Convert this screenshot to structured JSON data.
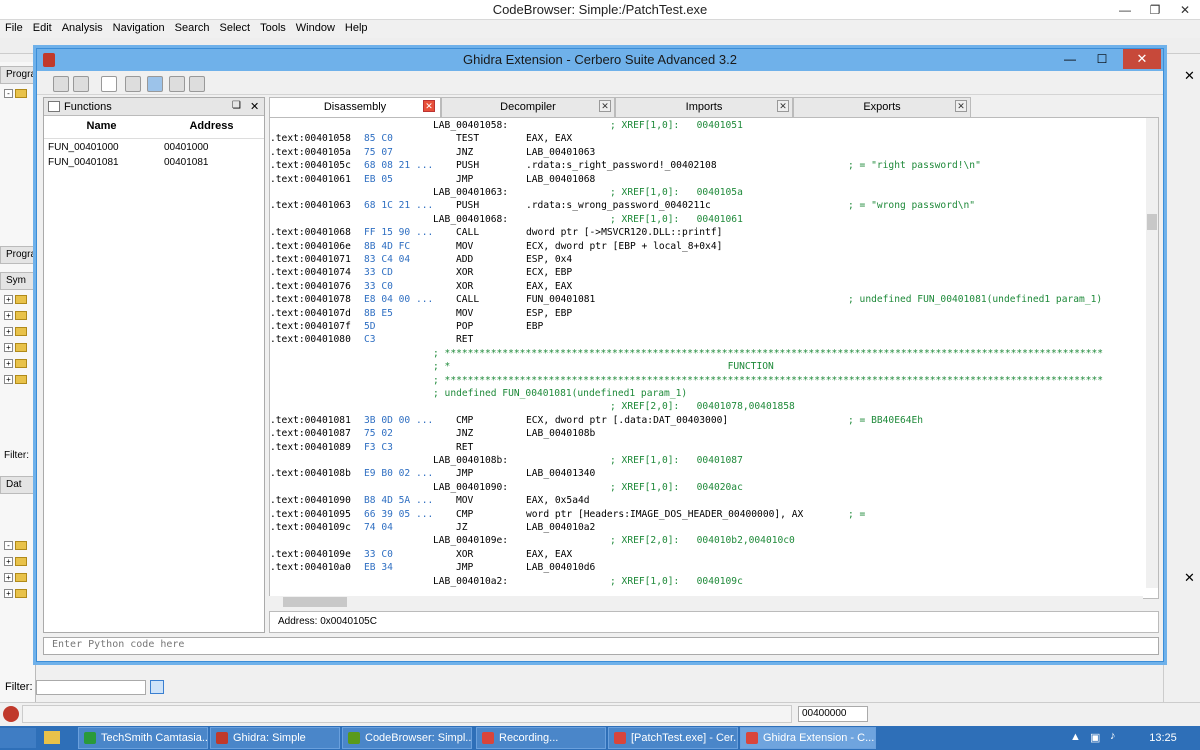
{
  "bg_window": {
    "title": "CodeBrowser: Simple:/PatchTest.exe",
    "menu": [
      "File",
      "Edit",
      "Analysis",
      "Navigation",
      "Search",
      "Select",
      "Tools",
      "Window",
      "Help"
    ],
    "left_tabs": [
      "Progra",
      "Progra",
      "Sym",
      "Dat"
    ],
    "filter_label": "Filter:",
    "filter_label_bottom": "Filter:",
    "status_address": "00400000"
  },
  "dialog": {
    "title": "Ghidra Extension - Cerbero Suite Advanced 3.2",
    "functions_panel": {
      "title": "Functions",
      "columns": [
        "Name",
        "Address"
      ],
      "rows": [
        {
          "name": "FUN_00401000",
          "address": "00401000"
        },
        {
          "name": "FUN_00401081",
          "address": "00401081"
        }
      ]
    },
    "tabs": [
      "Disassembly",
      "Decompiler",
      "Imports",
      "Exports"
    ],
    "address_bar": "Address: 0x0040105C",
    "python_placeholder": "Enter Python code here"
  },
  "listing": [
    {
      "label": "LAB_00401058:",
      "xref": "; XREF[1,0]:   00401051"
    },
    {
      "addr": ".text:00401058",
      "bytes": "85 C0",
      "mn": "TEST",
      "op": "EAX, EAX"
    },
    {
      "addr": ".text:0040105a",
      "bytes": "75 07",
      "mn": "JNZ",
      "op": "LAB_00401063"
    },
    {
      "addr": ".text:0040105c",
      "bytes": "68 08 21 ...",
      "mn": "PUSH",
      "op": ".rdata:s_right_password!_00402108",
      "cmt": "; = \"right password!\\n\""
    },
    {
      "addr": ".text:00401061",
      "bytes": "EB 05",
      "mn": "JMP",
      "op": "LAB_00401068"
    },
    {
      "label": "LAB_00401063:",
      "xref": "; XREF[1,0]:   0040105a"
    },
    {
      "addr": ".text:00401063",
      "bytes": "68 1C 21 ...",
      "mn": "PUSH",
      "op": ".rdata:s_wrong_password_0040211c",
      "cmt": "; = \"wrong password\\n\""
    },
    {
      "label": "LAB_00401068:",
      "xref": "; XREF[1,0]:   00401061"
    },
    {
      "addr": ".text:00401068",
      "bytes": "FF 15 90 ...",
      "mn": "CALL",
      "op": "dword ptr [->MSVCR120.DLL::printf]"
    },
    {
      "addr": ".text:0040106e",
      "bytes": "8B 4D FC",
      "mn": "MOV",
      "op": "ECX, dword ptr [EBP + local_8+0x4]"
    },
    {
      "addr": ".text:00401071",
      "bytes": "83 C4 04",
      "mn": "ADD",
      "op": "ESP, 0x4"
    },
    {
      "addr": ".text:00401074",
      "bytes": "33 CD",
      "mn": "XOR",
      "op": "ECX, EBP"
    },
    {
      "addr": ".text:00401076",
      "bytes": "33 C0",
      "mn": "XOR",
      "op": "EAX, EAX"
    },
    {
      "addr": ".text:00401078",
      "bytes": "E8 04 00 ...",
      "mn": "CALL",
      "op": "FUN_00401081",
      "cmt": "; undefined FUN_00401081(undefined1 param_1)"
    },
    {
      "addr": ".text:0040107d",
      "bytes": "8B E5",
      "mn": "MOV",
      "op": "ESP, EBP"
    },
    {
      "addr": ".text:0040107f",
      "bytes": "5D",
      "mn": "POP",
      "op": "EBP"
    },
    {
      "addr": ".text:00401080",
      "bytes": "C3",
      "mn": "RET",
      "op": ""
    },
    {
      "star": "; ******************************************************************************************************************"
    },
    {
      "star": "; *                                                FUNCTION"
    },
    {
      "star": "; ******************************************************************************************************************"
    },
    {
      "star": "; undefined FUN_00401081(undefined1 param_1)"
    },
    {
      "label": "",
      "xref": "; XREF[2,0]:   00401078,00401858"
    },
    {
      "addr": ".text:00401081",
      "bytes": "3B 0D 00 ...",
      "mn": "CMP",
      "op": "ECX, dword ptr [.data:DAT_00403000]",
      "cmt": "; = BB40E64Eh"
    },
    {
      "addr": ".text:00401087",
      "bytes": "75 02",
      "mn": "JNZ",
      "op": "LAB_0040108b"
    },
    {
      "addr": ".text:00401089",
      "bytes": "F3 C3",
      "mn": "RET",
      "op": ""
    },
    {
      "label": "LAB_0040108b:",
      "xref": "; XREF[1,0]:   00401087"
    },
    {
      "addr": ".text:0040108b",
      "bytes": "E9 B0 02 ...",
      "mn": "JMP",
      "op": "LAB_00401340"
    },
    {
      "label": "LAB_00401090:",
      "xref": "; XREF[1,0]:   004020ac"
    },
    {
      "addr": ".text:00401090",
      "bytes": "B8 4D 5A ...",
      "mn": "MOV",
      "op": "EAX, 0x5a4d"
    },
    {
      "addr": ".text:00401095",
      "bytes": "66 39 05 ...",
      "mn": "CMP",
      "op": "word ptr [Headers:IMAGE_DOS_HEADER_00400000], AX",
      "cmt": "; ="
    },
    {
      "addr": ".text:0040109c",
      "bytes": "74 04",
      "mn": "JZ",
      "op": "LAB_004010a2"
    },
    {
      "label": "LAB_0040109e:",
      "xref": "; XREF[2,0]:   004010b2,004010c0"
    },
    {
      "addr": ".text:0040109e",
      "bytes": "33 C0",
      "mn": "XOR",
      "op": "EAX, EAX"
    },
    {
      "addr": ".text:004010a0",
      "bytes": "EB 34",
      "mn": "JMP",
      "op": "LAB_004010d6"
    },
    {
      "label": "LAB_004010a2:",
      "xref": "; XREF[1,0]:   0040109c"
    }
  ],
  "taskbar": {
    "items": [
      {
        "label": "TechSmith Camtasia...",
        "color": "#2a9a3a"
      },
      {
        "label": "Ghidra: Simple",
        "color": "#c0392b"
      },
      {
        "label": "CodeBrowser: Simpl...",
        "color": "#5a9a1a"
      },
      {
        "label": "Recording...",
        "color": "#d9453b"
      },
      {
        "label": "[PatchTest.exe] - Cer...",
        "color": "#d9453b"
      },
      {
        "label": "Ghidra Extension - C...",
        "color": "#d9453b"
      }
    ],
    "clock": "13:25"
  }
}
